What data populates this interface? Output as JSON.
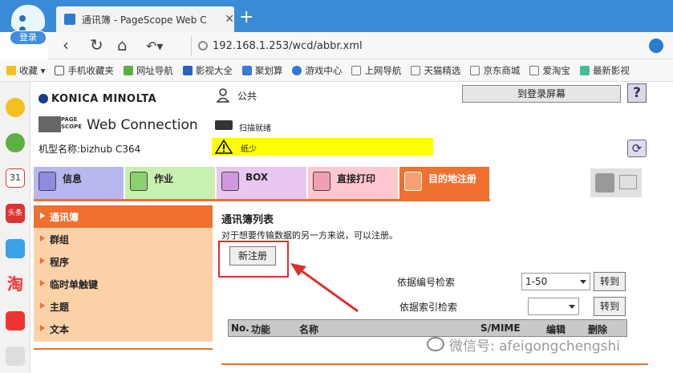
{
  "browser": {
    "login_label": "登录",
    "tab_title": "通讯簿 - PageScope Web C",
    "tab_close": "✕",
    "new_tab": "+",
    "url": "192.168.1.253/wcd/abbr.xml",
    "bookmarks": [
      "收藏",
      "手机收藏夹",
      "网址导航",
      "影视大全",
      "聚划算",
      "游戏中心",
      "上网导航",
      "天猫精选",
      "京东商城",
      "爱淘宝",
      "最新影视"
    ],
    "sidebar_icons": [
      "star-icon",
      "clock-icon",
      "calendar-icon",
      "toutiao-icon",
      "weather-icon",
      "taobao-icon",
      "shop-icon",
      "game-icon"
    ],
    "calendar_day": "31",
    "toutiao_label": "头条",
    "taobao_label": "淘"
  },
  "header": {
    "brand": "KONICA MINOLTA",
    "pagescope_logo": "PAGE SCOPE",
    "product": "Web Connection",
    "model": "机型名称:bizhub C364",
    "user": "公共",
    "goto_login": "到登录屏幕",
    "help": "?",
    "scanner_status": "扫描就绪",
    "warning": "纸少"
  },
  "tabs": {
    "info": "信息",
    "job": "作业",
    "box": "BOX",
    "direct_print": "直接打印",
    "destination": "目的地注册"
  },
  "menu": {
    "items": [
      "通讯簿",
      "群组",
      "程序",
      "临时单触键",
      "主题",
      "文本"
    ]
  },
  "content": {
    "title": "通讯簿列表",
    "description": "对于想要传输数据的另一方来说，可以注册。",
    "new_register": "新注册",
    "search_by_number": "依据编号检索",
    "search_by_index": "依据索引检索",
    "number_range": "1-50",
    "index_value": "",
    "go": "转到",
    "table_headers": [
      "No.",
      "功能",
      "名称",
      "S/MIME",
      "编辑",
      "删除"
    ]
  },
  "watermark": "微信号: afeigongchengshi"
}
